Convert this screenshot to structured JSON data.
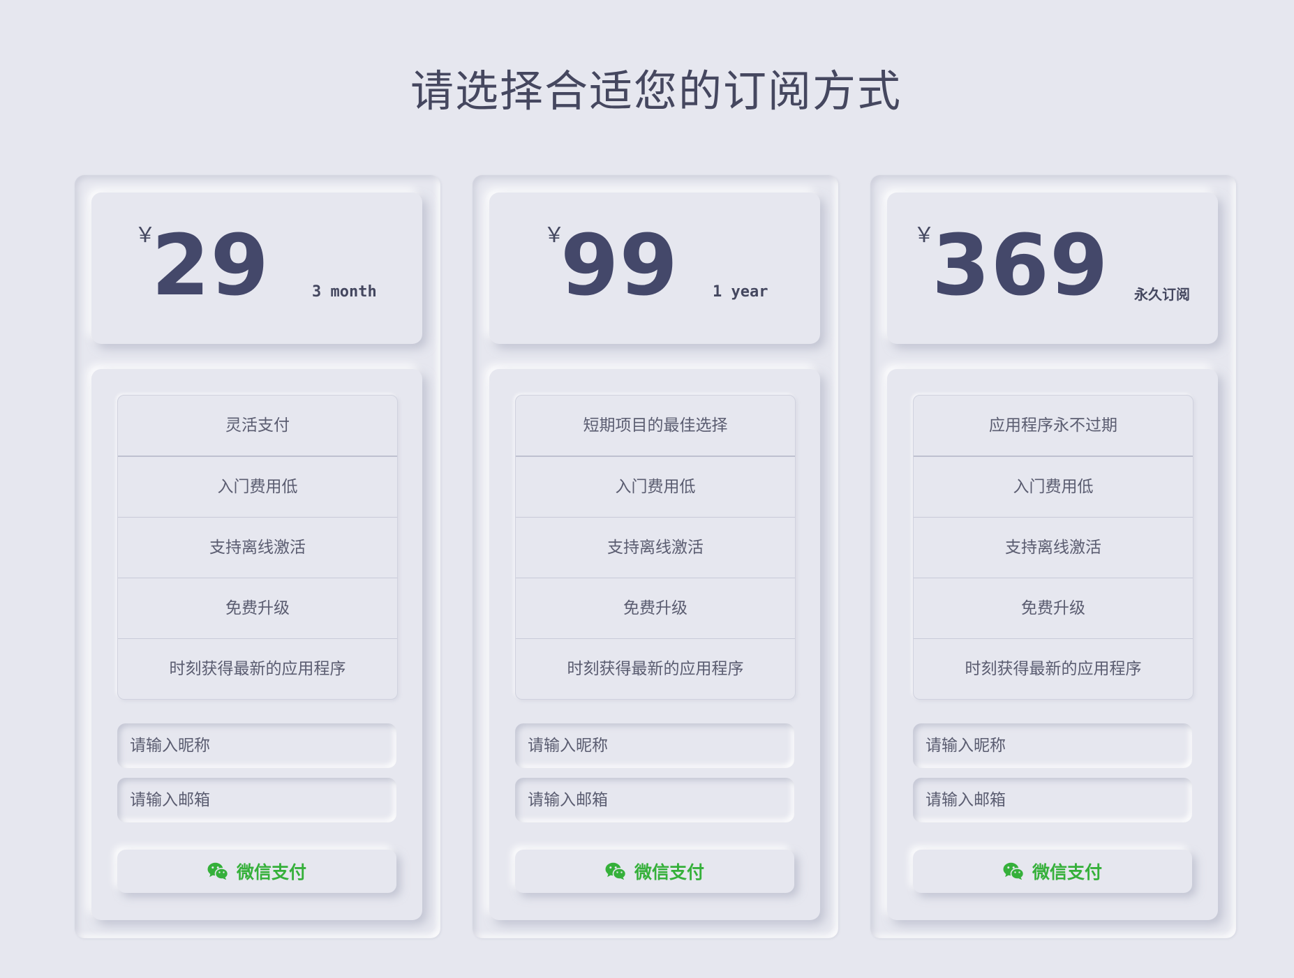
{
  "page": {
    "title": "请选择合适您的订阅方式"
  },
  "colors": {
    "background": "#e6e7ef",
    "text": "#44475f",
    "price": "#44486a",
    "wechat_green": "#35b03a"
  },
  "plans": [
    {
      "currency": "￥",
      "amount": "29",
      "period": "3 month",
      "features": [
        "灵活支付",
        "入门费用低",
        "支持离线激活",
        "免费升级",
        "时刻获得最新的应用程序"
      ],
      "nickname_placeholder": "请输入昵称",
      "email_placeholder": "请输入邮箱",
      "pay_icon": "wechat-icon",
      "pay_label": "微信支付"
    },
    {
      "currency": "￥",
      "amount": "99",
      "period": "1 year",
      "features": [
        "短期项目的最佳选择",
        "入门费用低",
        "支持离线激活",
        "免费升级",
        "时刻获得最新的应用程序"
      ],
      "nickname_placeholder": "请输入昵称",
      "email_placeholder": "请输入邮箱",
      "pay_icon": "wechat-icon",
      "pay_label": "微信支付"
    },
    {
      "currency": "￥",
      "amount": "369",
      "period": "永久订阅",
      "features": [
        "应用程序永不过期",
        "入门费用低",
        "支持离线激活",
        "免费升级",
        "时刻获得最新的应用程序"
      ],
      "nickname_placeholder": "请输入昵称",
      "email_placeholder": "请输入邮箱",
      "pay_icon": "wechat-icon",
      "pay_label": "微信支付"
    }
  ]
}
